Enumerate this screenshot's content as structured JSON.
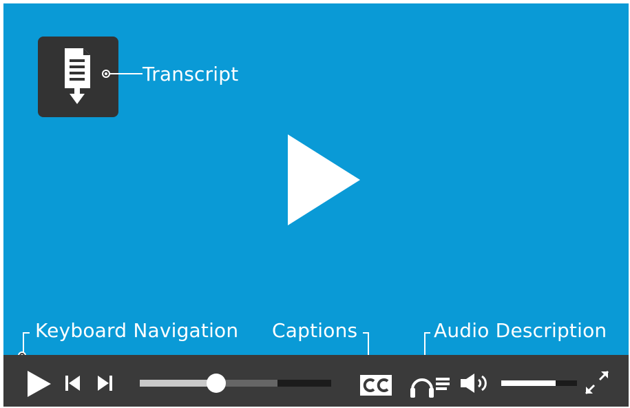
{
  "player": {
    "colors": {
      "background": "#0a9ad6",
      "control_bar": "#3a3a3a",
      "icon": "#ffffff",
      "overlay_button": "#333333"
    },
    "big_play_icon": "play-icon"
  },
  "annotations": {
    "transcript": "Transcript",
    "keyboard_navigation": "Keyboard Navigation",
    "captions": "Captions",
    "audio_description": "Audio Description"
  },
  "controls": {
    "progress": {
      "played": 0.4,
      "buffered": 0.72
    },
    "volume": {
      "level": 0.72
    },
    "icons": [
      "play-icon",
      "previous-icon",
      "next-icon",
      "captions-icon",
      "audio-description-icon",
      "volume-icon",
      "fullscreen-icon"
    ]
  }
}
